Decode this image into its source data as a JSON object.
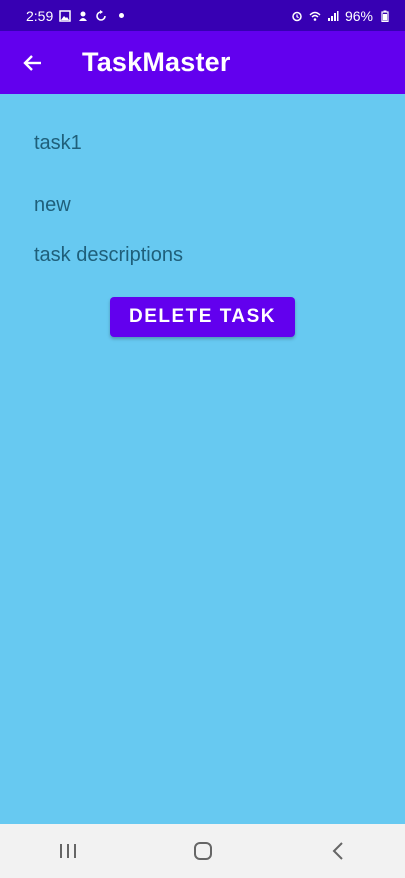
{
  "status_bar": {
    "time": "2:59",
    "battery": "96%",
    "left_icons": [
      "image-icon",
      "notification-icon",
      "sync-icon",
      "dot-icon"
    ],
    "right_icons": [
      "alarm-icon",
      "wifi-icon",
      "signal-icon",
      "battery-icon"
    ]
  },
  "app_bar": {
    "title": "TaskMaster",
    "back_icon": "arrow-left-icon"
  },
  "task": {
    "title": "task1",
    "state": "new",
    "description": "task descriptions"
  },
  "actions": {
    "delete_label": "DELETE TASK"
  },
  "nav_bar": {
    "icons": [
      "recent-apps-icon",
      "home-icon",
      "back-icon"
    ]
  },
  "colors": {
    "status_bar": "#3700b3",
    "app_bar": "#6200ee",
    "background": "#67c9f1",
    "button": "#6200ee",
    "text": "#1f5f7a"
  }
}
